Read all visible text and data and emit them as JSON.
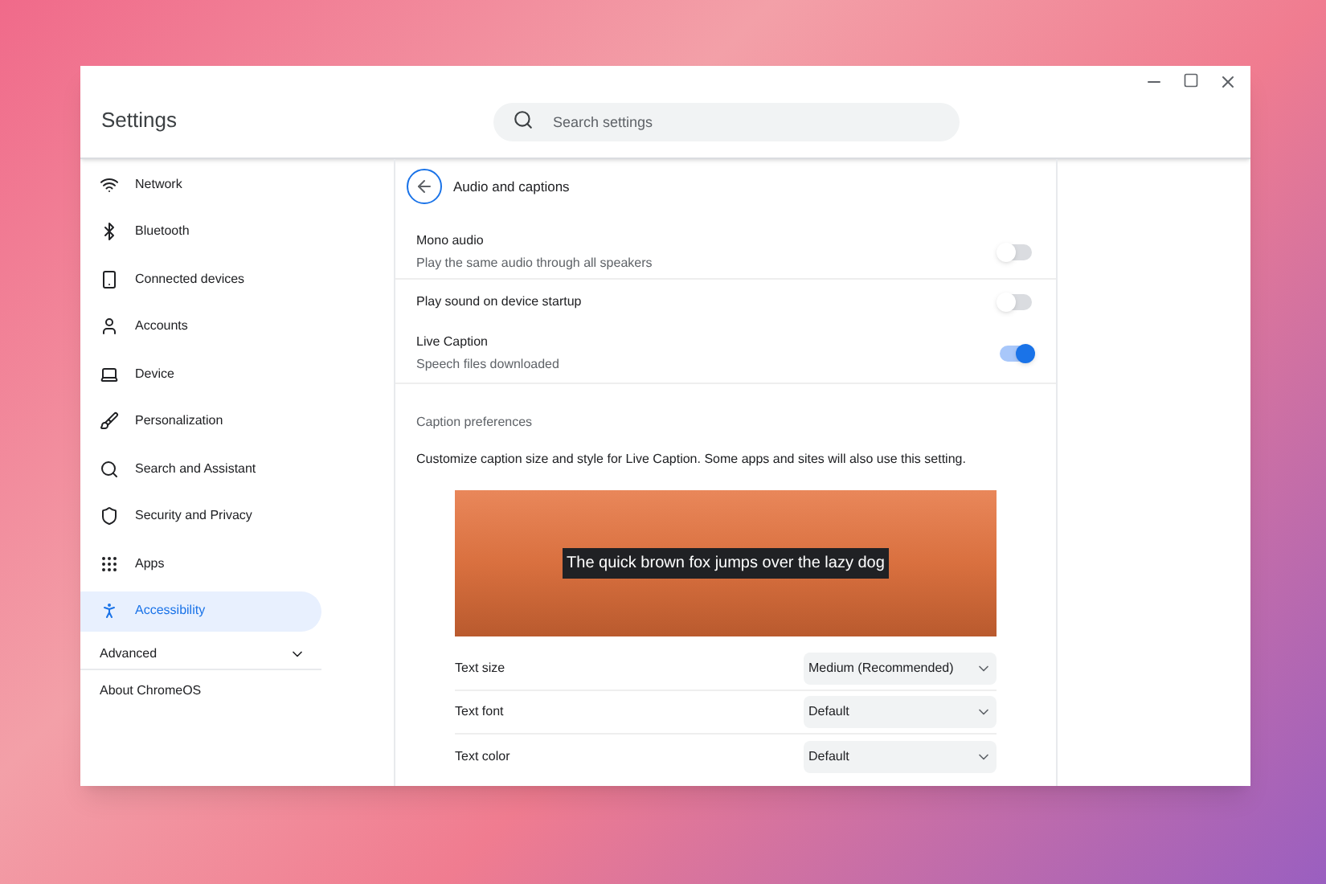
{
  "window": {
    "title": "Settings"
  },
  "search": {
    "placeholder": "Search settings"
  },
  "sidebar": {
    "items": [
      {
        "label": "Network",
        "selected": false
      },
      {
        "label": "Bluetooth",
        "selected": false
      },
      {
        "label": "Connected devices",
        "selected": false
      },
      {
        "label": "Accounts",
        "selected": false
      },
      {
        "label": "Device",
        "selected": false
      },
      {
        "label": "Personalization",
        "selected": false
      },
      {
        "label": "Search and Assistant",
        "selected": false
      },
      {
        "label": "Security and Privacy",
        "selected": false
      },
      {
        "label": "Apps",
        "selected": false
      },
      {
        "label": "Accessibility",
        "selected": true
      }
    ],
    "advanced": {
      "label": "Advanced",
      "expanded": false
    },
    "about": "About ChromeOS"
  },
  "page": {
    "title": "Audio and captions",
    "toggles": [
      {
        "label": "Mono audio",
        "description": "Play the same audio through all speakers",
        "on": false
      },
      {
        "label": "Play sound on device startup",
        "on": false
      },
      {
        "label": "Live Caption",
        "description": "Speech files downloaded",
        "on": true
      }
    ],
    "section_title": "Caption preferences",
    "section_description": "Customize caption size and style for Live Caption. Some apps and sites will also use this setting.",
    "preview_caption": "The quick brown fox jumps over the lazy dog",
    "dropdowns": [
      {
        "label": "Text size",
        "value": "Medium (Recommended)"
      },
      {
        "label": "Text font",
        "value": "Default"
      },
      {
        "label": "Text color",
        "value": "Default"
      }
    ]
  }
}
